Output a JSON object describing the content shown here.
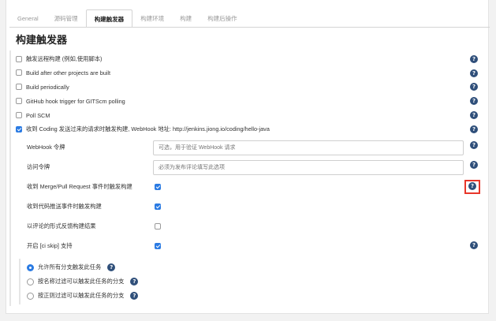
{
  "tabs": [
    {
      "label": "General"
    },
    {
      "label": "源码管理"
    },
    {
      "label": "构建触发器"
    },
    {
      "label": "构建环境"
    },
    {
      "label": "构建"
    },
    {
      "label": "构建后操作"
    }
  ],
  "page_title": "构建触发器",
  "triggers": [
    {
      "label": "触发远程构建 (例如,使用脚本)",
      "checked": false
    },
    {
      "label": "Build after other projects are built",
      "checked": false
    },
    {
      "label": "Build periodically",
      "checked": false
    },
    {
      "label": "GitHub hook trigger for GITScm polling",
      "checked": false
    },
    {
      "label": "Poll SCM",
      "checked": false
    },
    {
      "label": "收到 Coding 发送过来的请求时触发构建, WebHook 地址: http://jenkins.jiong.io/coding/hello-java",
      "checked": true
    }
  ],
  "coding": {
    "webhook_label": "WebHook 令牌",
    "webhook_placeholder": "可选，用于验证 WebHook 请求",
    "token_label": "访问令牌",
    "token_placeholder": "必须为发布评论填写此选项",
    "options": [
      {
        "label": "收到 Merge/Pull Request 事件时触发构建",
        "checked": true
      },
      {
        "label": "收到代码推送事件时触发构建",
        "checked": true
      },
      {
        "label": "以评论的形式反馈构建结果",
        "checked": false
      },
      {
        "label": "开启 [ci skip] 支持",
        "checked": true
      }
    ],
    "branch_radios": [
      {
        "label": "允许所有分支触发此任务",
        "selected": true
      },
      {
        "label": "按名称过滤可以触发此任务的分支",
        "selected": false
      },
      {
        "label": "按正则过滤可以触发此任务的分支",
        "selected": false
      }
    ]
  },
  "help_glyph": "?",
  "colors": {
    "accent": "#2b7be3",
    "help": "#2f4f7a",
    "highlight": "#e8362a"
  }
}
